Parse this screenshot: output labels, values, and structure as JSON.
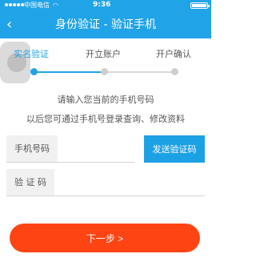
{
  "status": {
    "carrier": "中国电信",
    "time": "9:36"
  },
  "header": {
    "title": "身份验证 - 验证手机",
    "back_icon": "chevron-left-icon"
  },
  "steps": [
    {
      "label": "实名验证",
      "active": true
    },
    {
      "label": "开立账户",
      "active": false
    },
    {
      "label": "开户确认",
      "active": false
    }
  ],
  "hint": {
    "line1": "请输入您当前的手机号码",
    "line2": "以后您可通过手机号登录查询、修改资料"
  },
  "form": {
    "phone_label": "手机号码",
    "send_code_label": "发送验证码",
    "code_label": "验 证 码",
    "phone_value": "",
    "code_value": ""
  },
  "next_label": "下一步 >",
  "colors": {
    "primary": "#21a3e8",
    "accent": "#ff4414"
  }
}
